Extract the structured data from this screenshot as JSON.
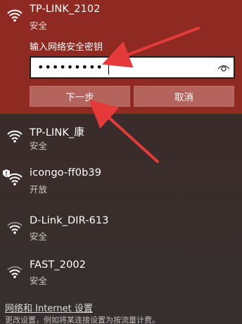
{
  "selected_network": {
    "name": "TP-LINK_2102",
    "status": "安全",
    "password_label": "输入网络安全密钥",
    "password_value": "•••••••••",
    "next_label": "下一步",
    "cancel_label": "取消",
    "accent_bg": "#8e2a22",
    "button_bg": "#b4645c"
  },
  "networks": [
    {
      "name": "TP-LINK_康",
      "status": "安全",
      "icon": "wifi-strong-icon"
    },
    {
      "name": "icongo-ff0b39",
      "status": "开放",
      "icon": "wifi-open-icon"
    },
    {
      "name": "D-Link_DIR-613",
      "status": "安全",
      "icon": "wifi-weak-icon"
    },
    {
      "name": "FAST_2002",
      "status": "安全",
      "icon": "wifi-weak-icon"
    }
  ],
  "footer": {
    "settings_link": "网络和 Internet 设置",
    "note": "更改设置，例如将某连接设置为按流量计费。"
  }
}
